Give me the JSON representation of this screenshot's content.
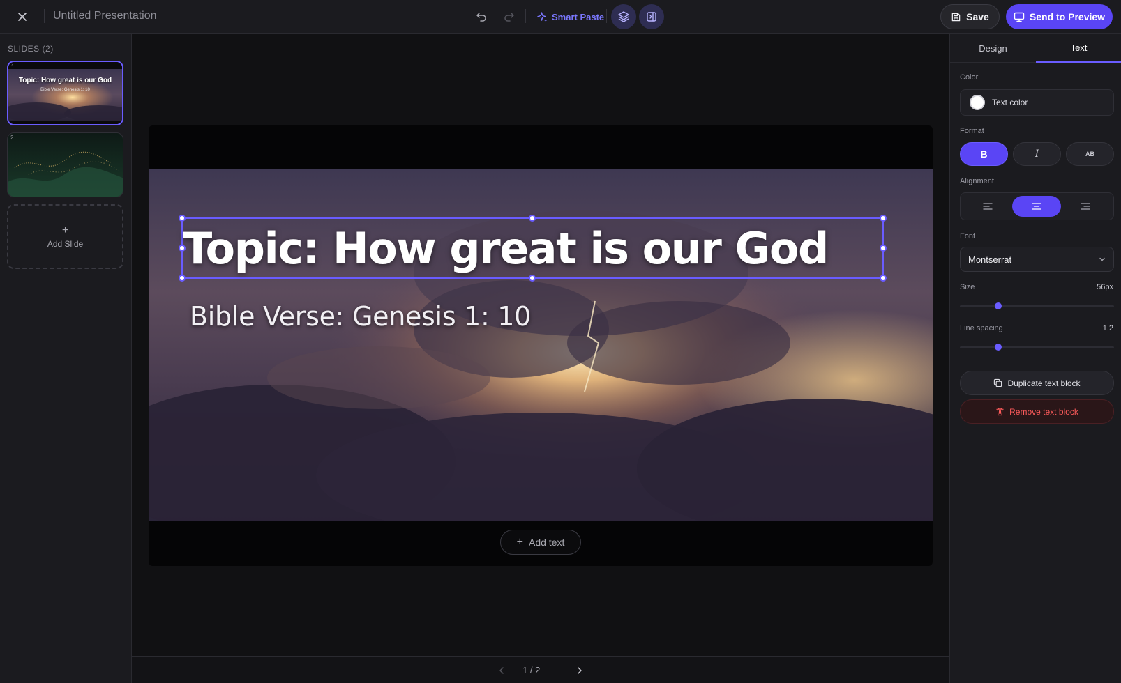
{
  "app": {
    "title": "Untitled Presentation",
    "close_icon": "close-icon",
    "undo_icon": "undo-icon",
    "redo_icon": "redo-icon"
  },
  "toolbar": {
    "smart_paste_label": "Smart Paste",
    "layers_icon": "layers-icon",
    "panel_toggle_icon": "panel-toggle-icon",
    "save_label": "Save",
    "preview_label": "Send to Preview"
  },
  "sidebar": {
    "heading": "SLIDES (2)",
    "slides": [
      {
        "number": "1",
        "title": "Topic: How great is our God",
        "subtitle": "Bible Verse: Genesis 1: 10",
        "selected": true
      },
      {
        "number": "2",
        "title": "",
        "subtitle": "",
        "selected": false
      }
    ],
    "add_slide_label": "Add Slide"
  },
  "slide": {
    "title": "Topic: How great is our God",
    "subtitle": "Bible Verse: Genesis 1: 10",
    "add_text_label": "Add text"
  },
  "pager": {
    "text": "1 / 2"
  },
  "panel": {
    "tabs": [
      {
        "label": "Design",
        "active": false
      },
      {
        "label": "Text",
        "active": true
      }
    ],
    "color_label": "Color",
    "color_text": "Text color",
    "color_value": "#ffffff",
    "format_label": "Format",
    "format_buttons": [
      {
        "label": "B",
        "active": true
      },
      {
        "label": "I",
        "active": false
      },
      {
        "label": "AB",
        "active": false
      }
    ],
    "alignment_label": "Alignment",
    "alignment_selected": "center",
    "font_label": "Font",
    "font_value": "Montserrat",
    "size_label": "Size",
    "size_value": "56px",
    "size_fraction": 0.25,
    "line_spacing_label": "Line spacing",
    "line_spacing_value": "1.2",
    "line_spacing_fraction": 0.25,
    "duplicate_label": "Duplicate text block",
    "remove_label": "Remove text block"
  },
  "colors": {
    "accent": "#5a45f5",
    "danger": "#ff5b5b"
  }
}
